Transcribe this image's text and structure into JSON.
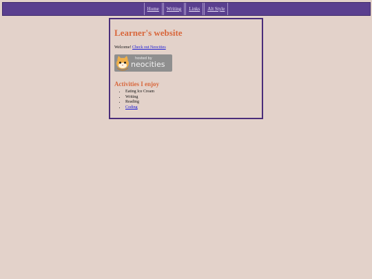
{
  "nav": {
    "items": [
      {
        "label": "Home"
      },
      {
        "label": "Writing"
      },
      {
        "label": "Links"
      },
      {
        "label": "Alt Style"
      }
    ]
  },
  "main": {
    "title": "Learner's website",
    "welcome_text": "Welcome!",
    "welcome_link": "Check out Neocities",
    "badge": {
      "text": "neocities",
      "subtext": "hosted by",
      "icon": "neocities-cat-icon"
    },
    "activities_title": "Activities I enjoy",
    "activities": [
      {
        "label": "Eating Ice Cream",
        "is_link": false
      },
      {
        "label": "Writing",
        "is_link": false
      },
      {
        "label": "Reading",
        "is_link": false
      },
      {
        "label": "Coding",
        "is_link": true
      }
    ]
  },
  "colors": {
    "background": "#e3d2ca",
    "nav_background": "#5a3f8f",
    "heading": "#d8673c",
    "link": "#1a1ad6",
    "border": "#4a2d7a"
  }
}
